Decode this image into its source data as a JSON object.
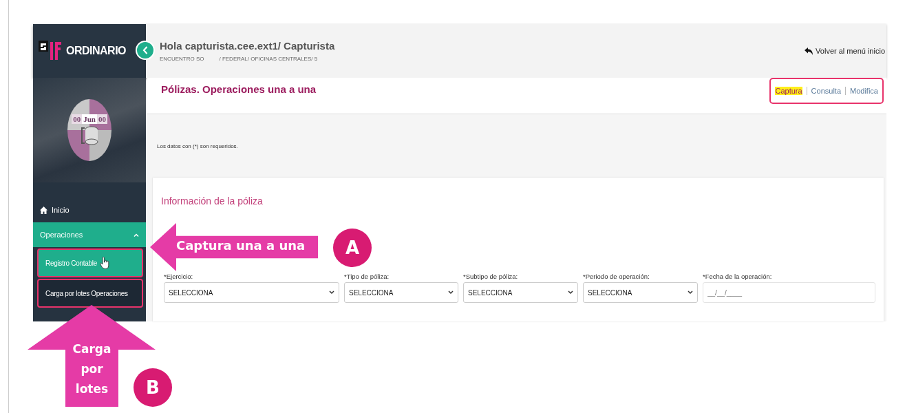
{
  "app": {
    "logo": "ORDINARIO",
    "calendar": [
      "00",
      "Jun",
      "00"
    ],
    "greeting": "Hola capturista.cee.ext1/ Capturista",
    "breadcrumb": [
      "ENCUENTRO SO",
      "/ FEDERAL/ OFICINAS CENTRALES/ 5"
    ],
    "back_link": "Volver al menú inicio"
  },
  "sidebar": {
    "items": [
      {
        "label": "Inicio",
        "kind": "link"
      },
      {
        "label": "Operaciones",
        "kind": "group",
        "expanded": true,
        "children": [
          {
            "label": "Registro Contable",
            "selected": true,
            "highlighted": true
          },
          {
            "label": "Carga por lotes Operaciones",
            "selected": false,
            "highlighted": true
          }
        ]
      }
    ]
  },
  "page": {
    "title": "Pólizas. Operaciones una a una",
    "tabs": [
      {
        "label": "Captura",
        "selected": true
      },
      {
        "label": "Consulta",
        "selected": false
      },
      {
        "label": "Modifica",
        "selected": false
      }
    ],
    "tabs_highlighted": true,
    "note": "Los datos con (*) son requeridos.",
    "section_title": "Información de la póliza",
    "fields": [
      {
        "label": "*Ejercicio:",
        "kind": "select",
        "value": "SELECCIONA"
      },
      {
        "label": "*Tipo de póliza:",
        "kind": "select",
        "value": "SELECCIONA"
      },
      {
        "label": "*Subtipo de póliza:",
        "kind": "select",
        "value": "SELECCIONA"
      },
      {
        "label": "*Periodo de operación:",
        "kind": "select",
        "value": "SELECCIONA"
      },
      {
        "label": "*Fecha de la operación:",
        "kind": "date",
        "placeholder": "__/__/____"
      }
    ]
  },
  "annotations": [
    {
      "kind": "arrow-left",
      "text": "Captura una a una",
      "marker": "A"
    },
    {
      "kind": "arrow-up",
      "text": "Carga por lotes",
      "marker": "B"
    }
  ]
}
